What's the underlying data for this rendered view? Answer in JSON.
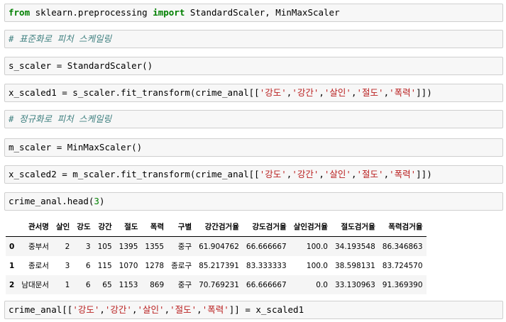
{
  "cells": [
    {
      "kw_from": "from",
      "module": " sklearn.preprocessing ",
      "kw_import": "import",
      "names": " StandardScaler, MinMaxScaler"
    },
    {
      "comment": "# 표준화로 피처 스케일링"
    },
    {
      "code": "s_scaler = StandardScaler()"
    },
    {
      "pre": "x_scaled1 = s_scaler.fit_transform(crime_anal[[",
      "s1": "'강도'",
      "c1": ",",
      "s2": "'강간'",
      "c2": ",",
      "s3": "'살인'",
      "c3": ",",
      "s4": "'절도'",
      "c4": ",",
      "s5": "'폭력'",
      "post": "]])"
    },
    {
      "comment": "# 정규화로 피처 스케일링"
    },
    {
      "code": "m_scaler = MinMaxScaler()"
    },
    {
      "pre": "x_scaled2 = m_scaler.fit_transform(crime_anal[[",
      "s1": "'강도'",
      "c1": ",",
      "s2": "'강간'",
      "c2": ",",
      "s3": "'살인'",
      "c3": ",",
      "s4": "'절도'",
      "c4": ",",
      "s5": "'폭력'",
      "post": "]])"
    },
    {
      "pre": "crime_anal.head(",
      "num": "3",
      "post": ")"
    },
    {
      "pre": "crime_anal[[",
      "s1": "'강도'",
      "c1": ",",
      "s2": "'강간'",
      "c2": ",",
      "s3": "'살인'",
      "c3": ",",
      "s4": "'절도'",
      "c4": ",",
      "s5": "'폭력'",
      "post": "]] = x_scaled1"
    }
  ],
  "table": {
    "columns": [
      "",
      "관서명",
      "살인",
      "강도",
      "강간",
      "절도",
      "폭력",
      "구별",
      "강간검거율",
      "강도검거율",
      "살인검거율",
      "절도검거율",
      "폭력검거율"
    ],
    "rows": [
      [
        "0",
        "중부서",
        "2",
        "3",
        "105",
        "1395",
        "1355",
        "중구",
        "61.904762",
        "66.666667",
        "100.0",
        "34.193548",
        "86.346863"
      ],
      [
        "1",
        "종로서",
        "3",
        "6",
        "115",
        "1070",
        "1278",
        "종로구",
        "85.217391",
        "83.333333",
        "100.0",
        "38.598131",
        "83.724570"
      ],
      [
        "2",
        "남대문서",
        "1",
        "6",
        "65",
        "1153",
        "869",
        "중구",
        "70.769231",
        "66.666667",
        "0.0",
        "33.130963",
        "91.369390"
      ]
    ]
  }
}
